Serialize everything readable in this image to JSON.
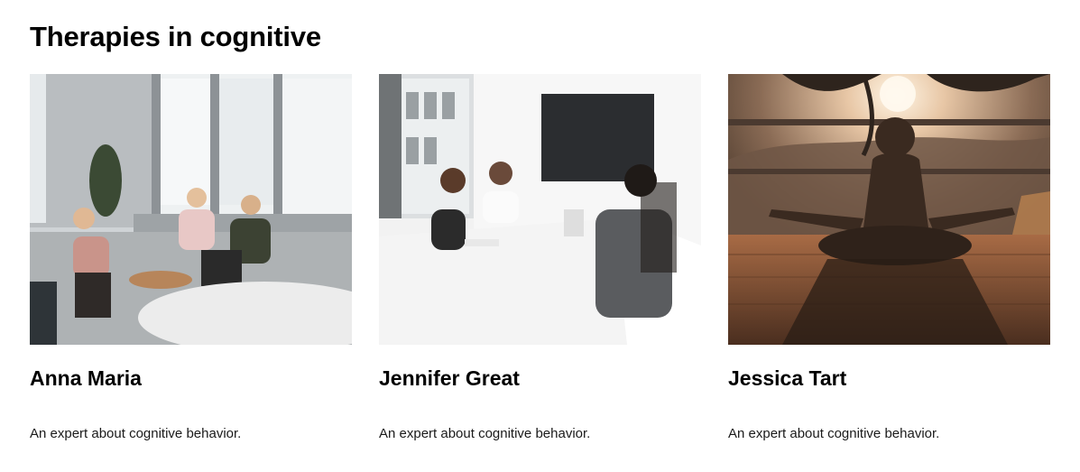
{
  "section": {
    "title": "Therapies in cognitive"
  },
  "cards": [
    {
      "name": "Anna Maria",
      "description": "An expert about cognitive behavior.",
      "image": "office-meeting-photo"
    },
    {
      "name": "Jennifer Great",
      "description": "An expert about cognitive behavior.",
      "image": "conference-table-photo"
    },
    {
      "name": "Jessica Tart",
      "description": "An expert about cognitive behavior.",
      "image": "sunset-meditation-photo"
    }
  ]
}
